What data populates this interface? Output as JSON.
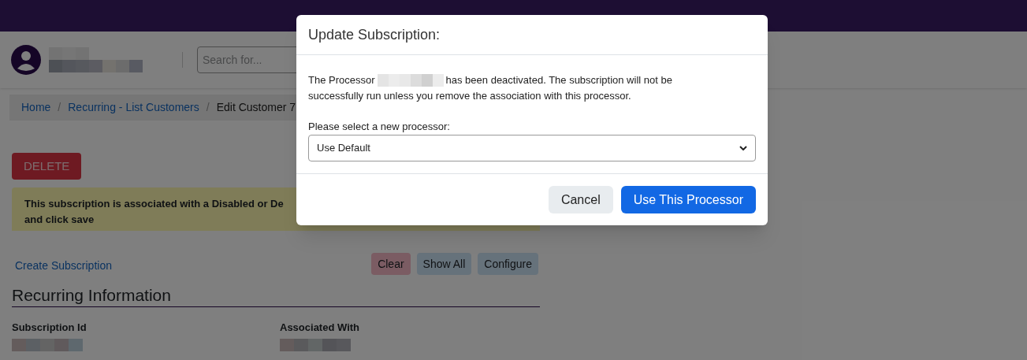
{
  "header": {
    "search": {
      "placeholder": "Search for..."
    }
  },
  "breadcrumb": [
    {
      "label": "Home",
      "kind": "link"
    },
    {
      "label": "/",
      "kind": "separator"
    },
    {
      "label": "Recurring - List Customers",
      "kind": "link"
    },
    {
      "label": "/",
      "kind": "separator"
    },
    {
      "label": "Edit Customer 7",
      "kind": "current"
    }
  ],
  "delete_button": "DELETE",
  "alert": {
    "lines": [
      "This subscription is associated with a Disabled or De",
      "and click save"
    ]
  },
  "create_link": "Create Subscription",
  "filter_buttons": [
    {
      "label": "Clear",
      "kind": "danger"
    },
    {
      "label": "Show All",
      "kind": "info"
    },
    {
      "label": "Configure",
      "kind": "info"
    }
  ],
  "section_title": "Recurring Information",
  "fields": [
    {
      "label": "Subscription Id"
    },
    {
      "label": "Associated With"
    }
  ],
  "dialog": {
    "title": "Update Subscription:",
    "message_start": "The Processor",
    "message_lines": [
      "has been deactivated. The subscription will not be",
      "successfully run unless you remove the association with this processor."
    ],
    "select_label": "Please select a new processor:",
    "select_value": "Use Default",
    "buttons": [
      {
        "label": "Cancel",
        "kind": "secondary"
      },
      {
        "label": "Use This Processor",
        "kind": "primary"
      }
    ]
  }
}
